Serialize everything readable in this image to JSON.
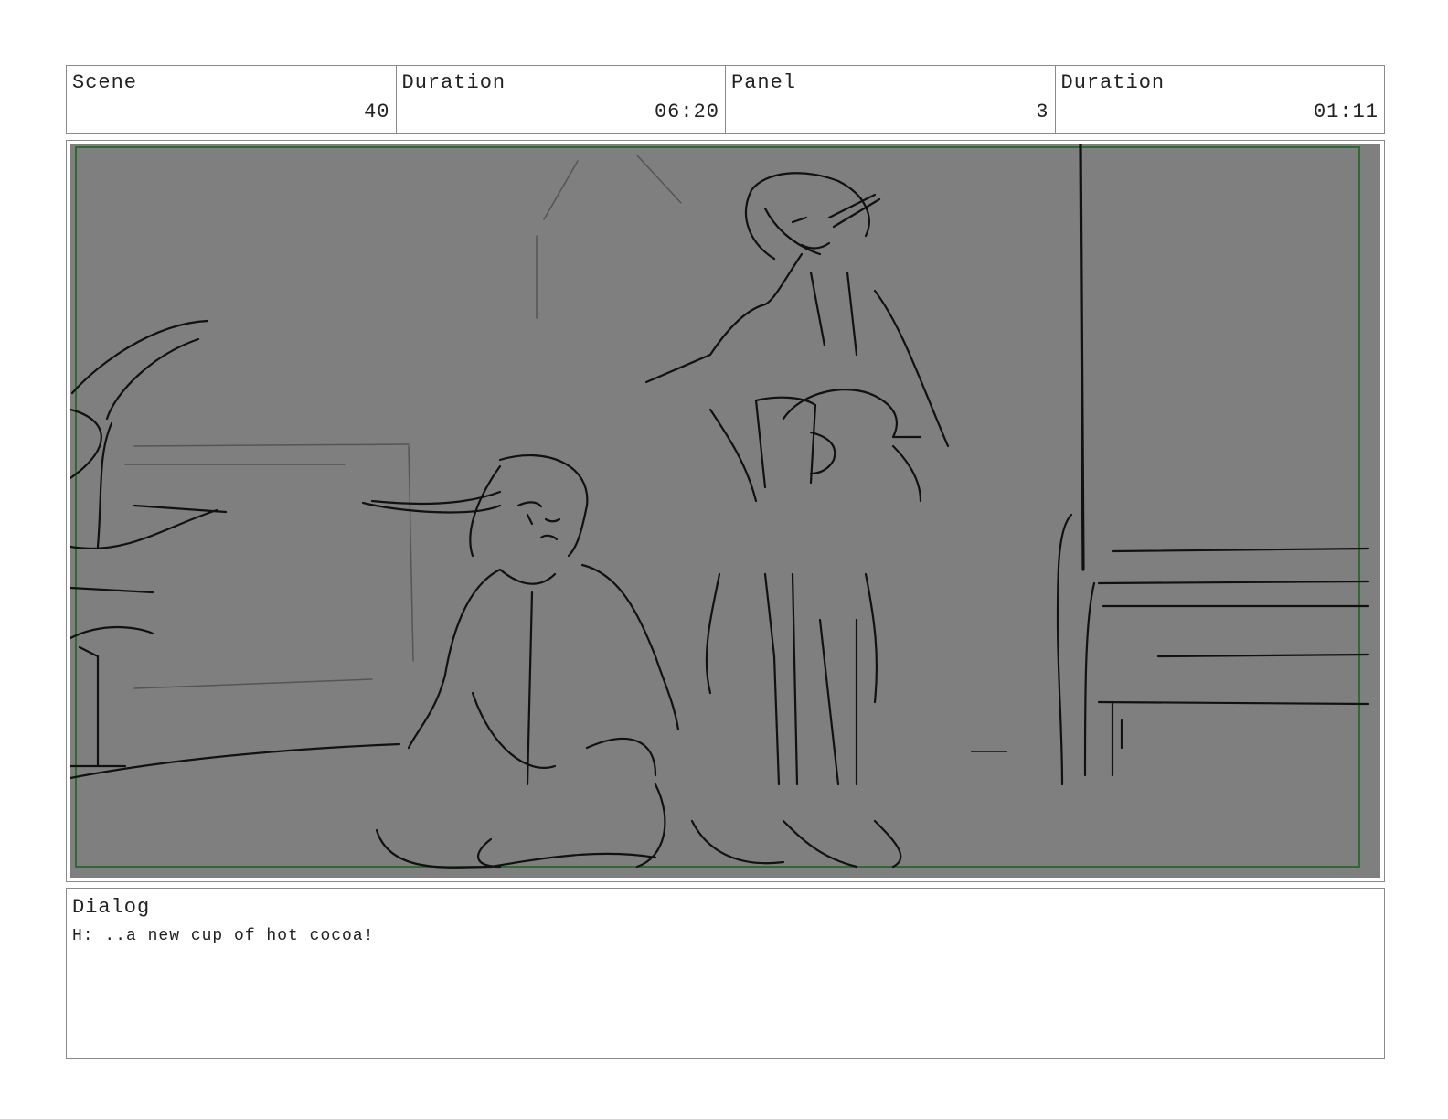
{
  "header": {
    "cells": [
      {
        "label": "Scene",
        "value": "40"
      },
      {
        "label": "Duration",
        "value": "06:20"
      },
      {
        "label": "Panel",
        "value": "3"
      },
      {
        "label": "Duration",
        "value": "01:11"
      }
    ]
  },
  "panel": {
    "background_color": "#7f7f7f",
    "border_color": "#2e6b2e",
    "line_color": "#111111"
  },
  "dialog": {
    "label": "Dialog",
    "text": "H: ..a new cup of hot cocoa!"
  }
}
